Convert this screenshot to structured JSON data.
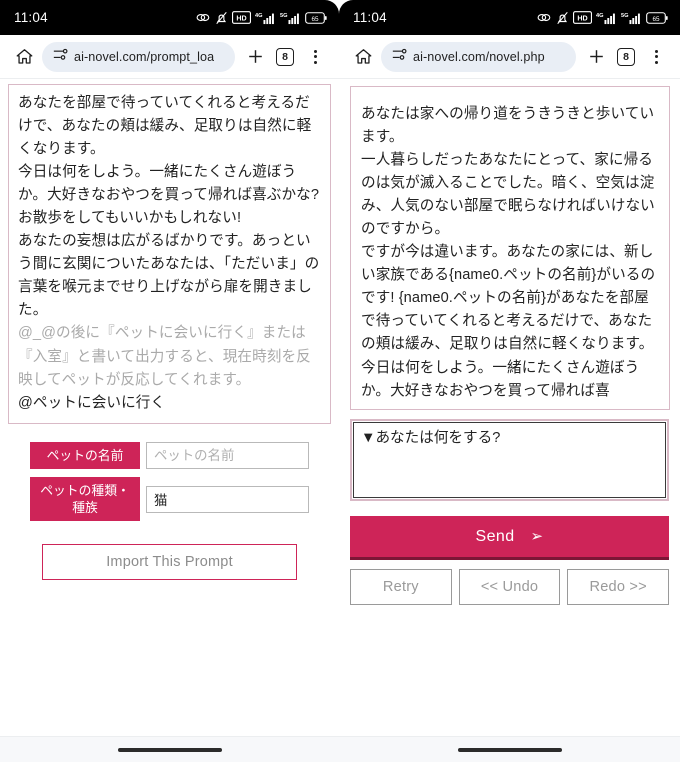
{
  "left": {
    "status": {
      "clock": "11:04",
      "icons": [
        "link-icon",
        "bell-muted-icon",
        "hd-icon",
        "4g-signal-icon",
        "5g-signal-icon",
        "battery-icon"
      ],
      "battery_level": "65"
    },
    "toolbar": {
      "home_icon": "home-icon",
      "site_settings_icon": "tune-sliders-icon",
      "url": "ai-novel.com/prompt_loa",
      "new_tab_icon": "plus-icon",
      "tab_count": "8",
      "menu_icon": "kebab-menu-icon"
    },
    "story": {
      "paragraphs": [
        "あなたを部屋で待っていてくれると考えるだけで、あなたの頬は緩み、足取りは自然に軽くなります。",
        "今日は何をしよう。一緒にたくさん遊ぼうか。大好きなおやつを買って帰れば喜ぶかな? お散歩をしてもいいかもしれない!",
        "あなたの妄想は広がるばかりです。あっという間に玄関についたあなたは、「ただいま」の言葉を喉元までせり上げながら扉を開きました。"
      ],
      "hint": "@_@の後に『ペットに会いに行く』または『入室』と書いて出力すると、現在時刻を反映してペットが反応してくれます。",
      "command": "@ペットに会いに行く"
    },
    "form": {
      "fields": [
        {
          "label": "ペットの名前",
          "value": "",
          "placeholder": "ペットの名前"
        },
        {
          "label": "ペットの種類・種族",
          "value": "猫",
          "placeholder": ""
        }
      ],
      "import_button": "Import This Prompt"
    }
  },
  "right": {
    "status": {
      "clock": "11:04",
      "icons": [
        "link-icon",
        "bell-muted-icon",
        "hd-icon",
        "4g-signal-icon",
        "5g-signal-icon",
        "battery-icon"
      ],
      "battery_level": "65"
    },
    "toolbar": {
      "home_icon": "home-icon",
      "site_settings_icon": "tune-sliders-icon",
      "url": "ai-novel.com/novel.php",
      "new_tab_icon": "plus-icon",
      "tab_count": "8",
      "menu_icon": "kebab-menu-icon"
    },
    "story": {
      "paragraphs": [
        "あなたは家への帰り道をうきうきと歩いています。",
        "一人暮らしだったあなたにとって、家に帰るのは気が滅入ることでした。暗く、空気は淀み、人気のない部屋で眠らなければいけないのですから。",
        "ですが今は違います。あなたの家には、新しい家族である{name0.ペットの名前}がいるのです! {name0.ペットの名前}があなたを部屋で待っていてくれると考えるだけで、あなたの頬は緩み、足取りは自然に軽くなります。",
        "今日は何をしよう。一緒にたくさん遊ぼうか。大好きなおやつを買って帰れば喜"
      ]
    },
    "controls": {
      "answer_value": "▼あなたは何をする?",
      "answer_placeholder": "",
      "send_label": "Send",
      "send_arrow": "➢",
      "buttons": [
        "Retry",
        "<< Undo",
        "Redo >>"
      ]
    }
  },
  "colors": {
    "accent": "#ce2458",
    "accent_dark": "#7d1636",
    "panel_border": "#d9b9c6",
    "muted_text": "#aaaaaa",
    "urlbar_bg": "#e9eef5"
  }
}
